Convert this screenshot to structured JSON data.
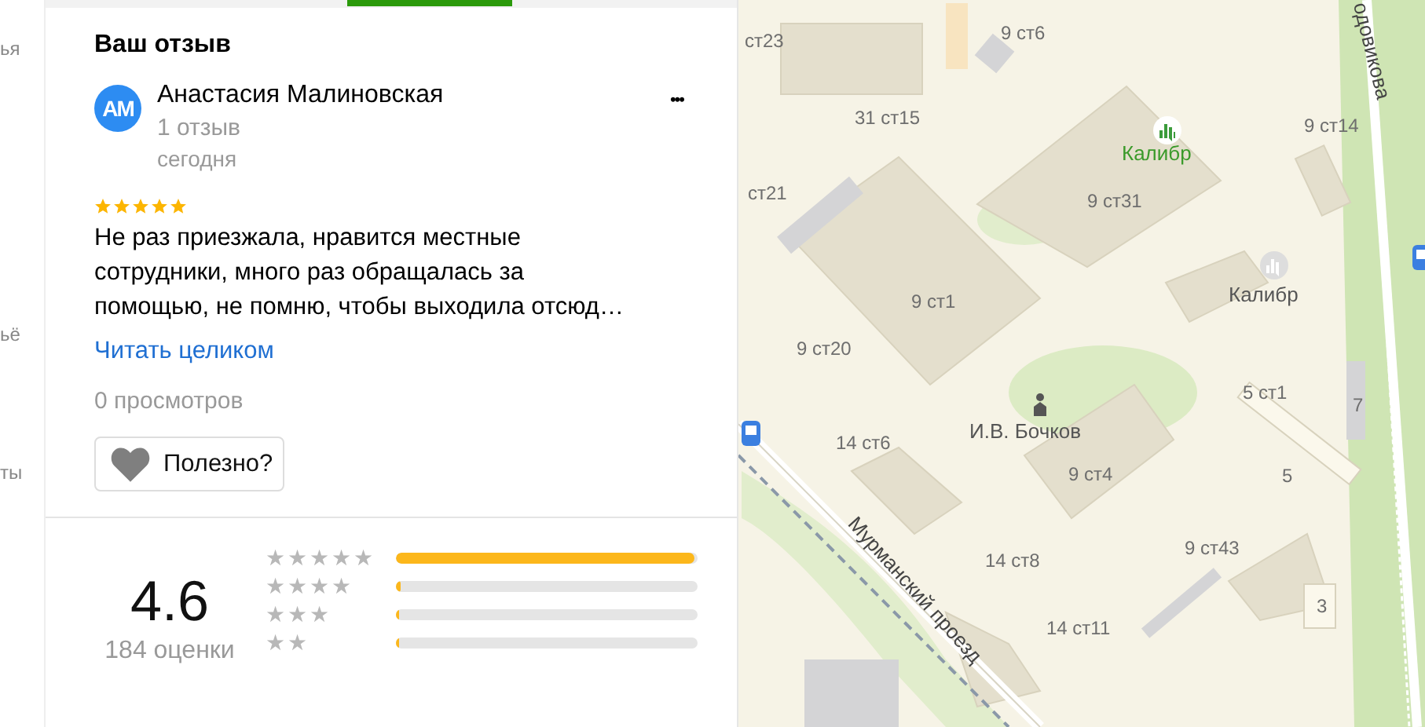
{
  "sidebar": {
    "fragments": [
      "ья",
      "ьё",
      "ты"
    ]
  },
  "tabs": [
    {
      "selected": true
    }
  ],
  "review": {
    "heading": "Ваш отзыв",
    "avatar": "АМ",
    "author": "Анастасия Малиновская",
    "more": "•••",
    "review_count": "1 отзыв",
    "date": "сегодня",
    "stars": 5,
    "text": "Не раз приезжала, нравится местные сотрудники, много раз обращалась за помощью, не помню, чтобы выходила отсюд…",
    "read_more": "Читать целиком",
    "views": "0 просмотров",
    "helpful_button": "Полезно?"
  },
  "rating": {
    "score": "4.6",
    "count": "184 оценки",
    "rows": [
      {
        "label": "★★★★★",
        "level": 0.99
      },
      {
        "label": "★★★★",
        "level": 0.015
      },
      {
        "label": "★★★",
        "level": 0.01
      },
      {
        "label": "★★",
        "level": 0.005
      }
    ]
  },
  "map": {
    "labels": [
      {
        "text": "ст23",
        "kind": "building"
      },
      {
        "text": "9 ст6",
        "kind": "building"
      },
      {
        "text": "31 ст15",
        "kind": "building"
      },
      {
        "text": "ст21",
        "kind": "building"
      },
      {
        "text": "Калибр",
        "kind": "poi"
      },
      {
        "text": "9 ст31",
        "kind": "building"
      },
      {
        "text": "9 ст14",
        "kind": "building"
      },
      {
        "text": "Калибр",
        "kind": "place"
      },
      {
        "text": "9 ст1",
        "kind": "building"
      },
      {
        "text": "9 ст20",
        "kind": "building"
      },
      {
        "text": "И.В. Бочков",
        "kind": "place"
      },
      {
        "text": "14 ст6",
        "kind": "building"
      },
      {
        "text": "5 ст1",
        "kind": "building"
      },
      {
        "text": "7",
        "kind": "building"
      },
      {
        "text": "9 ст4",
        "kind": "building"
      },
      {
        "text": "5",
        "kind": "building"
      },
      {
        "text": "9 ст43",
        "kind": "building"
      },
      {
        "text": "14 ст8",
        "kind": "building"
      },
      {
        "text": "3",
        "kind": "building"
      },
      {
        "text": "14 ст11",
        "kind": "building"
      },
      {
        "text": "Мурманский проезд",
        "kind": "street"
      },
      {
        "text": "одовикова",
        "kind": "street"
      }
    ]
  }
}
